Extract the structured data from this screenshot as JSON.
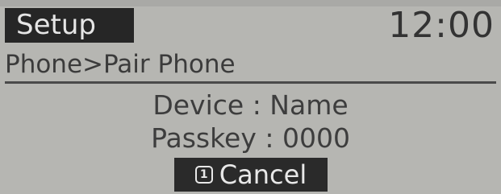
{
  "header": {
    "title": "Setup",
    "clock": "12:00"
  },
  "breadcrumb": "Phone>Pair Phone",
  "pairing": {
    "device_line": "Device : Name",
    "passkey_line": "Passkey : 0000"
  },
  "cancel": {
    "key": "1",
    "label": "Cancel"
  },
  "colors": {
    "screen_bg": "#b6b6b2",
    "title_bg": "#262626",
    "button_bg": "#2a2a2a",
    "text": "#3a3a3a",
    "inverse_text": "#e6e6e6"
  }
}
